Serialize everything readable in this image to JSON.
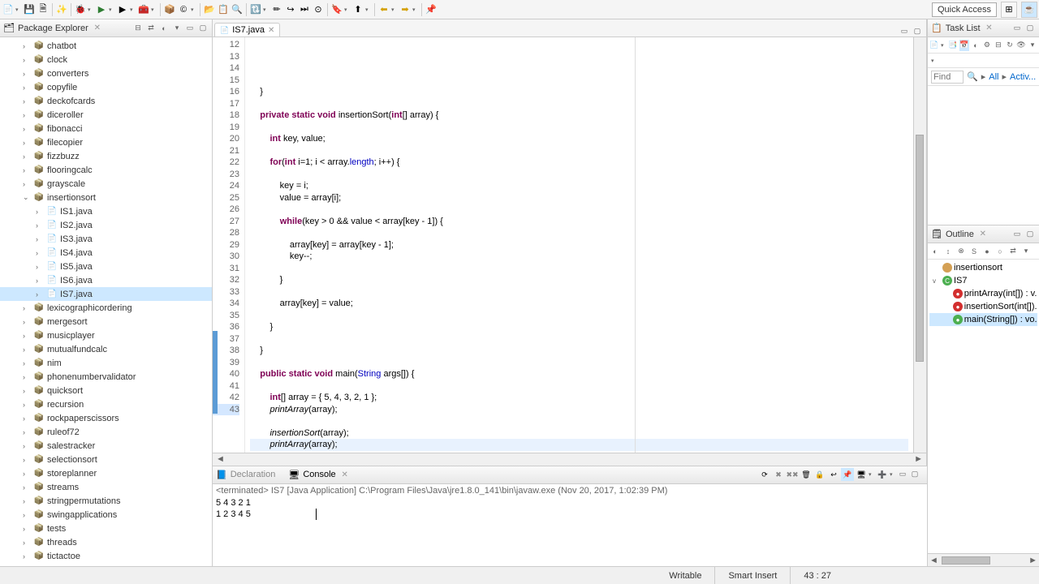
{
  "quick_access": "Quick Access",
  "package_explorer": {
    "title": "Package Explorer",
    "packages": [
      {
        "name": "chatbot",
        "expanded": false
      },
      {
        "name": "clock",
        "expanded": false
      },
      {
        "name": "converters",
        "expanded": false
      },
      {
        "name": "copyfile",
        "expanded": false
      },
      {
        "name": "deckofcards",
        "expanded": false
      },
      {
        "name": "diceroller",
        "expanded": false
      },
      {
        "name": "fibonacci",
        "expanded": false
      },
      {
        "name": "filecopier",
        "expanded": false
      },
      {
        "name": "fizzbuzz",
        "expanded": false
      },
      {
        "name": "flooringcalc",
        "expanded": false
      },
      {
        "name": "grayscale",
        "expanded": false
      },
      {
        "name": "insertionsort",
        "expanded": true,
        "children": [
          {
            "name": "IS1.java"
          },
          {
            "name": "IS2.java"
          },
          {
            "name": "IS3.java"
          },
          {
            "name": "IS4.java"
          },
          {
            "name": "IS5.java"
          },
          {
            "name": "IS6.java"
          },
          {
            "name": "IS7.java",
            "selected": true
          }
        ]
      },
      {
        "name": "lexicographicordering",
        "expanded": false
      },
      {
        "name": "mergesort",
        "expanded": false
      },
      {
        "name": "musicplayer",
        "expanded": false
      },
      {
        "name": "mutualfundcalc",
        "expanded": false
      },
      {
        "name": "nim",
        "expanded": false
      },
      {
        "name": "phonenumbervalidator",
        "expanded": false
      },
      {
        "name": "quicksort",
        "expanded": false
      },
      {
        "name": "recursion",
        "expanded": false
      },
      {
        "name": "rockpaperscissors",
        "expanded": false
      },
      {
        "name": "ruleof72",
        "expanded": false
      },
      {
        "name": "salestracker",
        "expanded": false
      },
      {
        "name": "selectionsort",
        "expanded": false
      },
      {
        "name": "storeplanner",
        "expanded": false
      },
      {
        "name": "streams",
        "expanded": false
      },
      {
        "name": "stringpermutations",
        "expanded": false
      },
      {
        "name": "swingapplications",
        "expanded": false
      },
      {
        "name": "tests",
        "expanded": false
      },
      {
        "name": "threads",
        "expanded": false
      },
      {
        "name": "tictactoe",
        "expanded": false
      }
    ]
  },
  "editor": {
    "tab": "IS7.java",
    "first_line": 12,
    "code_html": "<div>&nbsp;</div><div>    }</div><div>&nbsp;</div><div>    <span class='kw'>private static void</span> insertionSort(<span class='kw'>int</span>[] array) {</div><div>&nbsp;</div><div>        <span class='kw'>int</span> key, value;</div><div>&nbsp;</div><div>        <span class='kw'>for</span>(<span class='kw'>int</span> i=1; i &lt; array.<span class='fld'>length</span>; i++) {</div><div>&nbsp;</div><div>            key = i;</div><div>            value = array[i];</div><div>&nbsp;</div><div>            <span class='kw'>while</span>(key &gt; 0 &amp;&amp; value &lt; array[key - 1]) {</div><div>&nbsp;</div><div>                array[key] = array[key - 1];</div><div>                key--;</div><div>&nbsp;</div><div>            }</div><div>&nbsp;</div><div>            array[key] = value;</div><div>&nbsp;</div><div>        }</div><div>&nbsp;</div><div>    }</div><div>&nbsp;</div><div>    <span class='kw'>public static void</span> main(<span class='fld'>String</span> args[]) {</div><div>&nbsp;</div><div>        <span class='kw'>int</span>[] array = { 5, 4, 3, 2, 1 };</div><div>        <span class='mth'>printArray</span>(array);</div><div>&nbsp;</div><div>        <span class='mth'>insertionSort</span>(array);</div><div class='current-line'>        <span class='mth'>printArray</span>(array);</div>"
  },
  "console": {
    "tab_decl": "Declaration",
    "tab_console": "Console",
    "info": "<terminated> IS7 [Java Application] C:\\Program Files\\Java\\jre1.8.0_141\\bin\\javaw.exe (Nov 20, 2017, 1:02:39 PM)",
    "line1": "5 4 3 2 1",
    "line2": "1 2 3 4 5"
  },
  "task_list": {
    "title": "Task List",
    "find": "Find",
    "all": "All",
    "activ": "Activ..."
  },
  "outline": {
    "title": "Outline",
    "items": [
      {
        "label": "insertionsort",
        "type": "pkg",
        "depth": 0
      },
      {
        "label": "IS7",
        "type": "class",
        "depth": 0,
        "arrow": "v"
      },
      {
        "label": "printArray(int[]) : v...",
        "type": "priv",
        "depth": 1
      },
      {
        "label": "insertionSort(int[])...",
        "type": "priv",
        "depth": 1
      },
      {
        "label": "main(String[]) : vo...",
        "type": "pub",
        "depth": 1,
        "sel": true
      }
    ]
  },
  "status": {
    "writable": "Writable",
    "insert": "Smart Insert",
    "pos": "43 : 27"
  }
}
